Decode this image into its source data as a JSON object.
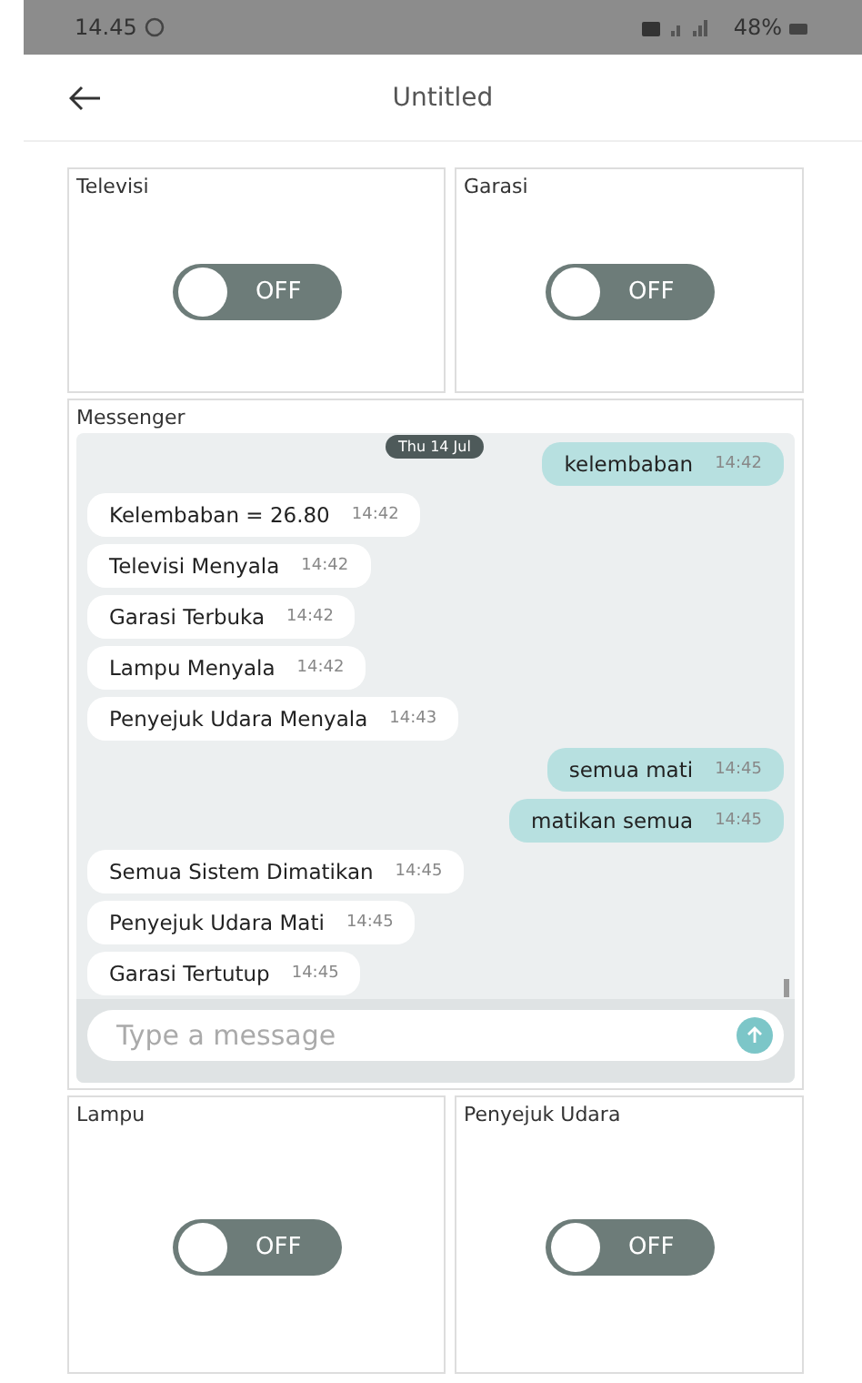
{
  "status_bar": {
    "time": "14.45",
    "battery": "48%"
  },
  "header": {
    "title": "Untitled"
  },
  "top_widgets": [
    {
      "title": "Televisi",
      "on": false,
      "label": "OFF"
    },
    {
      "title": "Garasi",
      "on": false,
      "label": "OFF"
    }
  ],
  "messenger": {
    "title": "Messenger",
    "date": "Thu 14 Jul",
    "placeholder": "Type a message",
    "messages": [
      {
        "kind": "out",
        "text": "kelembaban",
        "time": "14:42"
      },
      {
        "kind": "in",
        "text": "Kelembaban = 26.80",
        "time": "14:42"
      },
      {
        "kind": "in",
        "text": "Televisi Menyala",
        "time": "14:42"
      },
      {
        "kind": "in",
        "text": "Garasi Terbuka",
        "time": "14:42"
      },
      {
        "kind": "in",
        "text": "Lampu Menyala",
        "time": "14:42"
      },
      {
        "kind": "in",
        "text": "Penyejuk Udara Menyala",
        "time": "14:43"
      },
      {
        "kind": "out",
        "text": "semua mati",
        "time": "14:45"
      },
      {
        "kind": "out",
        "text": "matikan semua",
        "time": "14:45"
      },
      {
        "kind": "in",
        "text": "Semua Sistem Dimatikan",
        "time": "14:45"
      },
      {
        "kind": "in",
        "text": "Penyejuk Udara Mati",
        "time": "14:45"
      },
      {
        "kind": "in",
        "text": "Garasi Tertutup",
        "time": "14:45"
      }
    ]
  },
  "bottom_widgets": [
    {
      "title": "Lampu",
      "on": false,
      "label": "OFF"
    },
    {
      "title": "Penyejuk Udara",
      "on": false,
      "label": "OFF"
    }
  ]
}
